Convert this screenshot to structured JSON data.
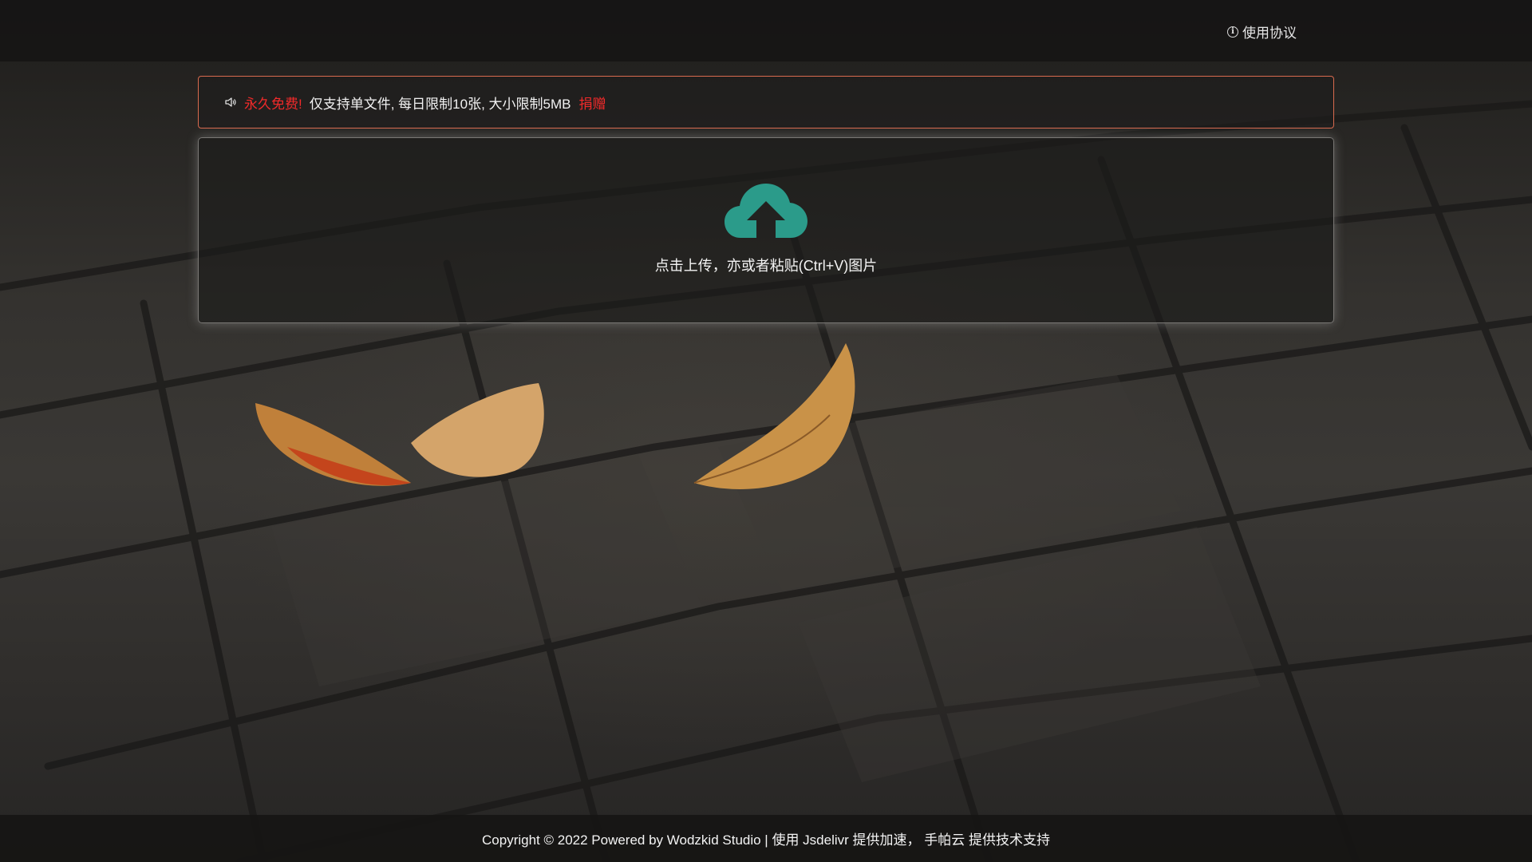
{
  "topbar": {
    "agreement_label": "使用协议",
    "agreement_icon": "info-icon"
  },
  "notice": {
    "icon": "speaker-icon",
    "free_text": "永久免费!",
    "rules_text": "仅支持单文件, 每日限制10张, 大小限制5MB",
    "donate_label": "捐赠",
    "highlight_color": "#f22a2a",
    "border_color": "#d86a4e"
  },
  "upload": {
    "icon": "cloud-upload-icon",
    "icon_color": "#2b9b8a",
    "hint": "点击上传，亦或者粘贴(Ctrl+V)图片"
  },
  "footer": {
    "text": "Copyright © 2022 Powered by Wodzkid Studio | 使用 Jsdelivr 提供加速， 手帕云 提供技术支持"
  }
}
